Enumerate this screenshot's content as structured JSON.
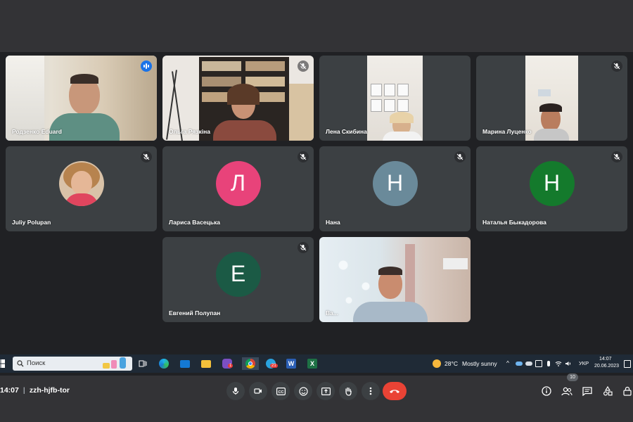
{
  "participants": [
    {
      "name": "Родзенко Eduard",
      "mic": "speaking"
    },
    {
      "name": "Ольга Рязкіна",
      "mic": "muted"
    },
    {
      "name": "Лена Скибина",
      "mic": "none"
    },
    {
      "name": "Марина Луценко",
      "mic": "muted"
    },
    {
      "name": "Juliy Polupan",
      "mic": "muted"
    },
    {
      "name": "Лариса Васецька",
      "mic": "muted",
      "initial": "Л",
      "color": "#e8437a"
    },
    {
      "name": "Нана",
      "mic": "muted",
      "initial": "Н",
      "color": "#6a8a9a"
    },
    {
      "name": "Наталья Быкадорова",
      "mic": "muted",
      "initial": "Н",
      "color": "#147a2c"
    },
    {
      "name": "Евгений Полупан",
      "mic": "muted",
      "initial": "Е",
      "color": "#1b5a45"
    },
    {
      "name": "Ва...",
      "mic": "none"
    }
  ],
  "meeting": {
    "time": "14:07",
    "code": "zzh-hjfb-tor",
    "people_count": "10"
  },
  "controls": [
    "mic-icon",
    "camera-icon",
    "captions-icon",
    "emoji-icon",
    "present-icon",
    "raise-hand-icon",
    "more-vert-icon",
    "end-call-icon"
  ],
  "taskbar": {
    "search_placeholder": "Поиск",
    "chrome_badge": "1",
    "telegram_badge": "21",
    "weather_temp": "28°C",
    "weather_text": "Mostly sunny",
    "language": "УКР",
    "clock_time": "14:07",
    "clock_date": "20.06.2023"
  },
  "colors": {
    "accent": "#8ab4f8",
    "end_call": "#ea4335",
    "tile": "#3c4043",
    "stage": "#202124"
  }
}
